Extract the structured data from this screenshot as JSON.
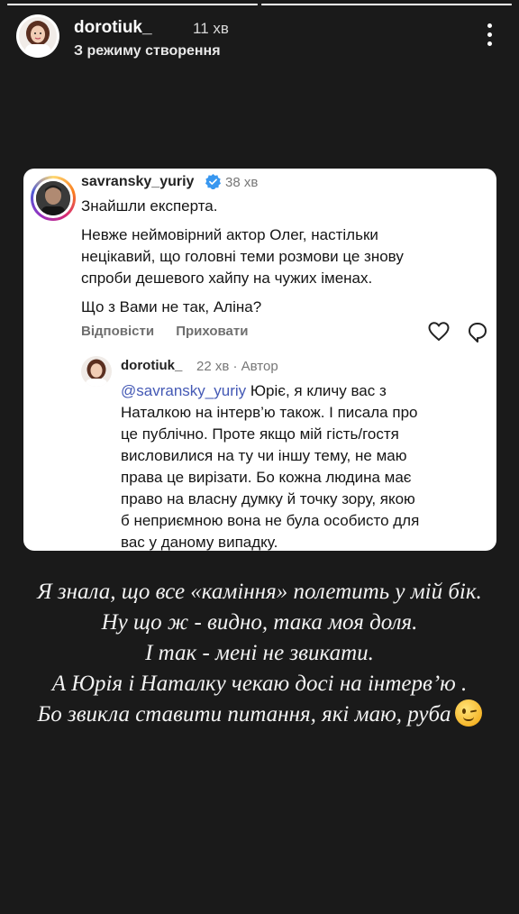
{
  "story": {
    "progress": [
      {
        "fill": 1.0
      },
      {
        "fill": 1.0
      },
      {
        "fill": 0.0
      }
    ]
  },
  "header": {
    "username": "dorotiuk_",
    "time": "11 хв",
    "subtitle": "З режиму створення"
  },
  "comment": {
    "username": "savransky_yuriy",
    "time": "38 хв",
    "text": [
      "Знайшли експерта.",
      "Невже неймовірний актор Олег, настільки",
      "нецікавий, що головні теми розмови це знову",
      "спроби дешевого хайпу на чужих іменах.",
      "Що з Вами не так, Аліна?"
    ],
    "actions": {
      "reply": "Відповісти",
      "hide": "Приховати"
    }
  },
  "reply": {
    "username": "dorotiuk_",
    "meta": "22 хв · Автор",
    "mention": "@savransky_yuriy",
    "text_first": " Юріє, я кличу вас з",
    "text": [
      "Наталкою на інтерв’ю також. І писала про",
      "це публічно. Проте якщо мій гість/гостя",
      "висловилися на ту чи іншу тему, не маю",
      "права це вирізати. Бо кожна людина має",
      "право на власну думку й точку зору, якою",
      "б неприємною вона не була особисто для",
      "вас у даному випадку."
    ]
  },
  "story_text": [
    "Я знала, що все «каміння» полетить у мій бік.",
    "Ну що ж - видно, така моя доля.",
    "І так - мені не звикати.",
    "А Юрія і Наталку чекаю досі на інтерв’ю .",
    "Бо звикла ставити питання, які маю, руба"
  ],
  "colors": {
    "background": "#1a1a1a",
    "mention": "#4459b5",
    "verified": "#3897f0"
  },
  "icons": [
    "more-vertical-icon",
    "verified-badge-icon",
    "heart-icon",
    "reply-icon",
    "wink-emoji-icon"
  ]
}
